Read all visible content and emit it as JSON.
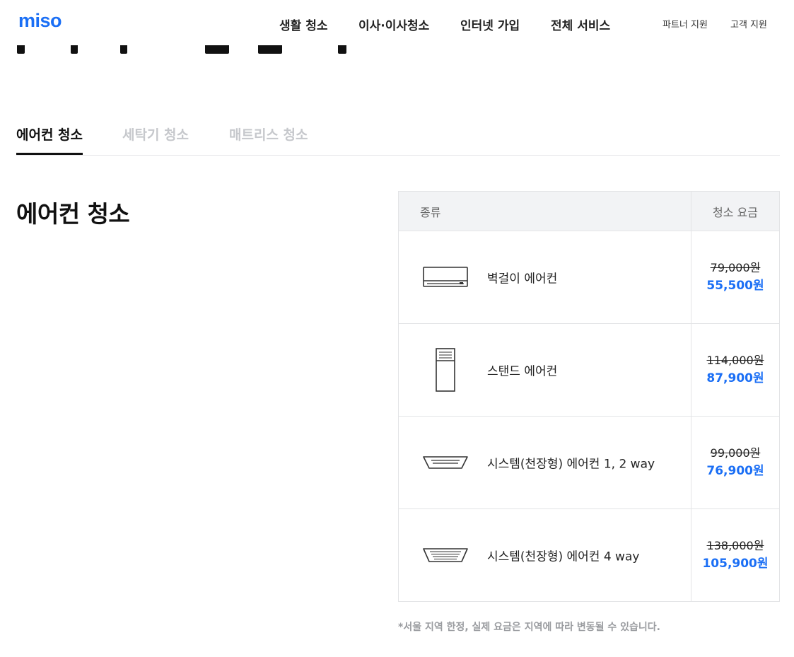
{
  "header": {
    "logo": "miso",
    "nav": [
      "생활 청소",
      "이사·이사청소",
      "인터넷 가입",
      "전체 서비스"
    ],
    "subnav": [
      "파트너 지원",
      "고객 지원"
    ]
  },
  "tabs": [
    {
      "label": "에어컨 청소",
      "active": true
    },
    {
      "label": "세탁기 청소",
      "active": false
    },
    {
      "label": "매트리스 청소",
      "active": false
    }
  ],
  "section": {
    "title": "에어컨 청소"
  },
  "table": {
    "headers": {
      "type": "종류",
      "price": "청소 요금"
    },
    "rows": [
      {
        "icon": "wall-aircon-icon",
        "name": "벽걸이 에어컨",
        "original_price": "79,000원",
        "sale_price": "55,500원"
      },
      {
        "icon": "stand-aircon-icon",
        "name": "스탠드 에어컨",
        "original_price": "114,000원",
        "sale_price": "87,900원"
      },
      {
        "icon": "ceiling-aircon-2way-icon",
        "name": "시스템(천장형) 에어컨 1, 2 way",
        "original_price": "99,000원",
        "sale_price": "76,900원"
      },
      {
        "icon": "ceiling-aircon-4way-icon",
        "name": "시스템(천장형) 에어컨 4 way",
        "original_price": "138,000원",
        "sale_price": "105,900원"
      }
    ]
  },
  "footnote": "*서울 지역 한정, 실제 요금은 지역에 따라 변동될 수 있습니다.",
  "colors": {
    "accent": "#1b6ff5",
    "header_bg": "#f2f3f5",
    "muted": "#c6c8cc"
  }
}
